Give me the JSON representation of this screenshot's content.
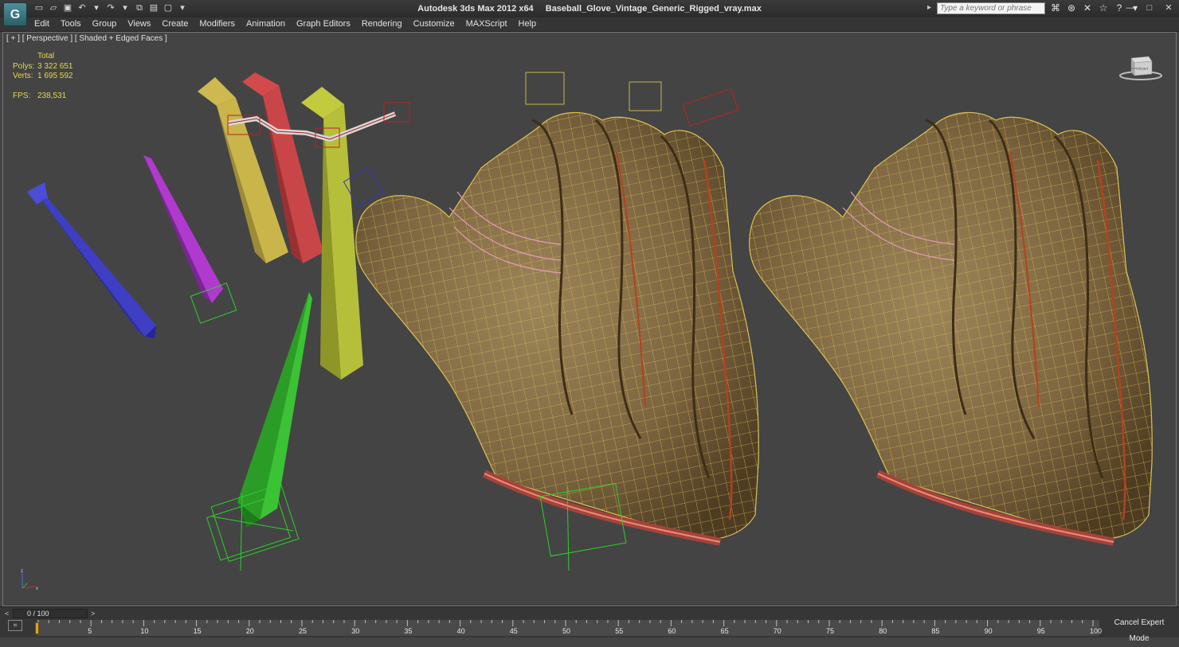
{
  "window": {
    "app_logo": "G",
    "app_title": "Autodesk 3ds Max  2012 x64",
    "file_name": "Baseball_Glove_Vintage_Generic_Rigged_vray.max"
  },
  "quick_access": [
    {
      "name": "new-file-icon",
      "glyph": "▭"
    },
    {
      "name": "open-file-icon",
      "glyph": "▱"
    },
    {
      "name": "save-icon",
      "glyph": "▣"
    },
    {
      "name": "undo-icon",
      "glyph": "↶"
    },
    {
      "name": "undo-dropdown-icon",
      "glyph": "▾"
    },
    {
      "name": "redo-icon",
      "glyph": "↷"
    },
    {
      "name": "redo-dropdown-icon",
      "glyph": "▾"
    },
    {
      "name": "hold-icon",
      "glyph": "⧉"
    },
    {
      "name": "project-folder-icon",
      "glyph": "▤"
    },
    {
      "name": "workspace-icon",
      "glyph": "▢"
    },
    {
      "name": "qat-dropdown-icon",
      "glyph": "▾"
    }
  ],
  "search": {
    "arrow_glyph": "▸",
    "placeholder": "Type a keyword or phrase"
  },
  "infocenter_icons": [
    {
      "name": "binoculars-icon",
      "glyph": "⌘"
    },
    {
      "name": "subscription-icon",
      "glyph": "⊛"
    },
    {
      "name": "communication-icon",
      "glyph": "✕"
    },
    {
      "name": "favorites-star-icon",
      "glyph": "☆"
    },
    {
      "name": "help-icon",
      "glyph": "?"
    },
    {
      "name": "help-dropdown-icon",
      "glyph": "▾"
    }
  ],
  "window_controls": {
    "minimize": "—",
    "maximize": "□",
    "close": "✕"
  },
  "menu": [
    "Edit",
    "Tools",
    "Group",
    "Views",
    "Create",
    "Modifiers",
    "Animation",
    "Graph Editors",
    "Rendering",
    "Customize",
    "MAXScript",
    "Help"
  ],
  "viewport": {
    "label": "[ + ] [ Perspective ] [ Shaded + Edged Faces ]",
    "stats": {
      "header": "Total",
      "polys_label": "Polys:",
      "polys_value": "3 322 651",
      "verts_label": "Verts:",
      "verts_value": "1 695 592",
      "fps_label": "FPS:",
      "fps_value": "238,531"
    },
    "viewcube": {
      "front": "FRONT",
      "side": "RIGHT"
    },
    "axis": {
      "z": "z",
      "x": "x"
    },
    "colors": {
      "glove_fill": "#8a7047",
      "wire": "#d9c354",
      "lacing": "#a5433a",
      "bone_blue": "#3e3fc4",
      "bone_purple": "#a12fbc",
      "bone_yellow": "#c9b54a",
      "bone_red": "#c94648",
      "bone_lime": "#b6bf3a",
      "bone_green": "#33b02d"
    }
  },
  "timeline": {
    "prev_glyph": "<",
    "next_glyph": ">",
    "frame_display": "0 / 100",
    "ticks": [
      "0",
      "5",
      "10",
      "15",
      "20",
      "25",
      "30",
      "35",
      "40",
      "45",
      "50",
      "55",
      "60",
      "65",
      "70",
      "75",
      "80",
      "85",
      "90",
      "95",
      "100"
    ],
    "expert_button": "Cancel Expert Mode",
    "key_mode_glyph": "⌗"
  }
}
